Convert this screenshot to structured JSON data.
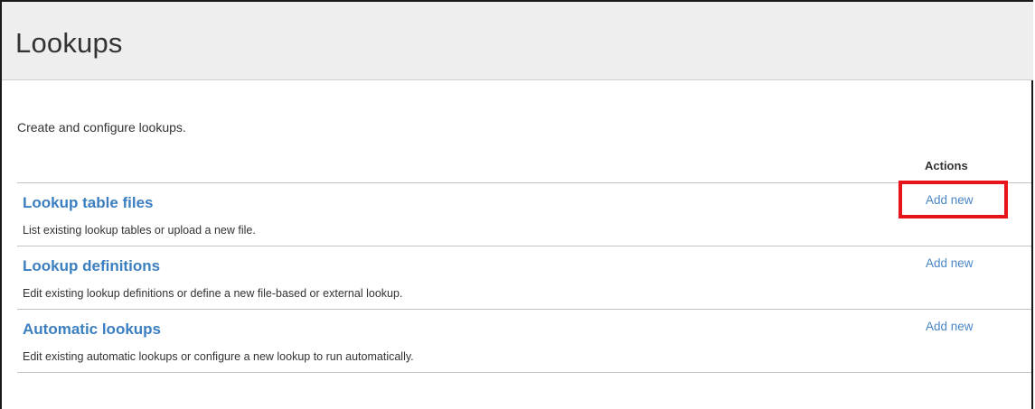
{
  "page": {
    "title": "Lookups",
    "description": "Create and configure lookups."
  },
  "table": {
    "actions_header": "Actions",
    "rows": [
      {
        "title": "Lookup table files",
        "description": "List existing lookup tables or upload a new file.",
        "action": "Add new"
      },
      {
        "title": "Lookup definitions",
        "description": "Edit existing lookup definitions or define a new file-based or external lookup.",
        "action": "Add new"
      },
      {
        "title": "Automatic lookups",
        "description": "Edit existing automatic lookups or configure a new lookup to run automatically.",
        "action": "Add new"
      }
    ]
  },
  "colors": {
    "link": "#3c7fc1",
    "highlight": "#e8141c",
    "header_bg": "#eeeeee"
  }
}
